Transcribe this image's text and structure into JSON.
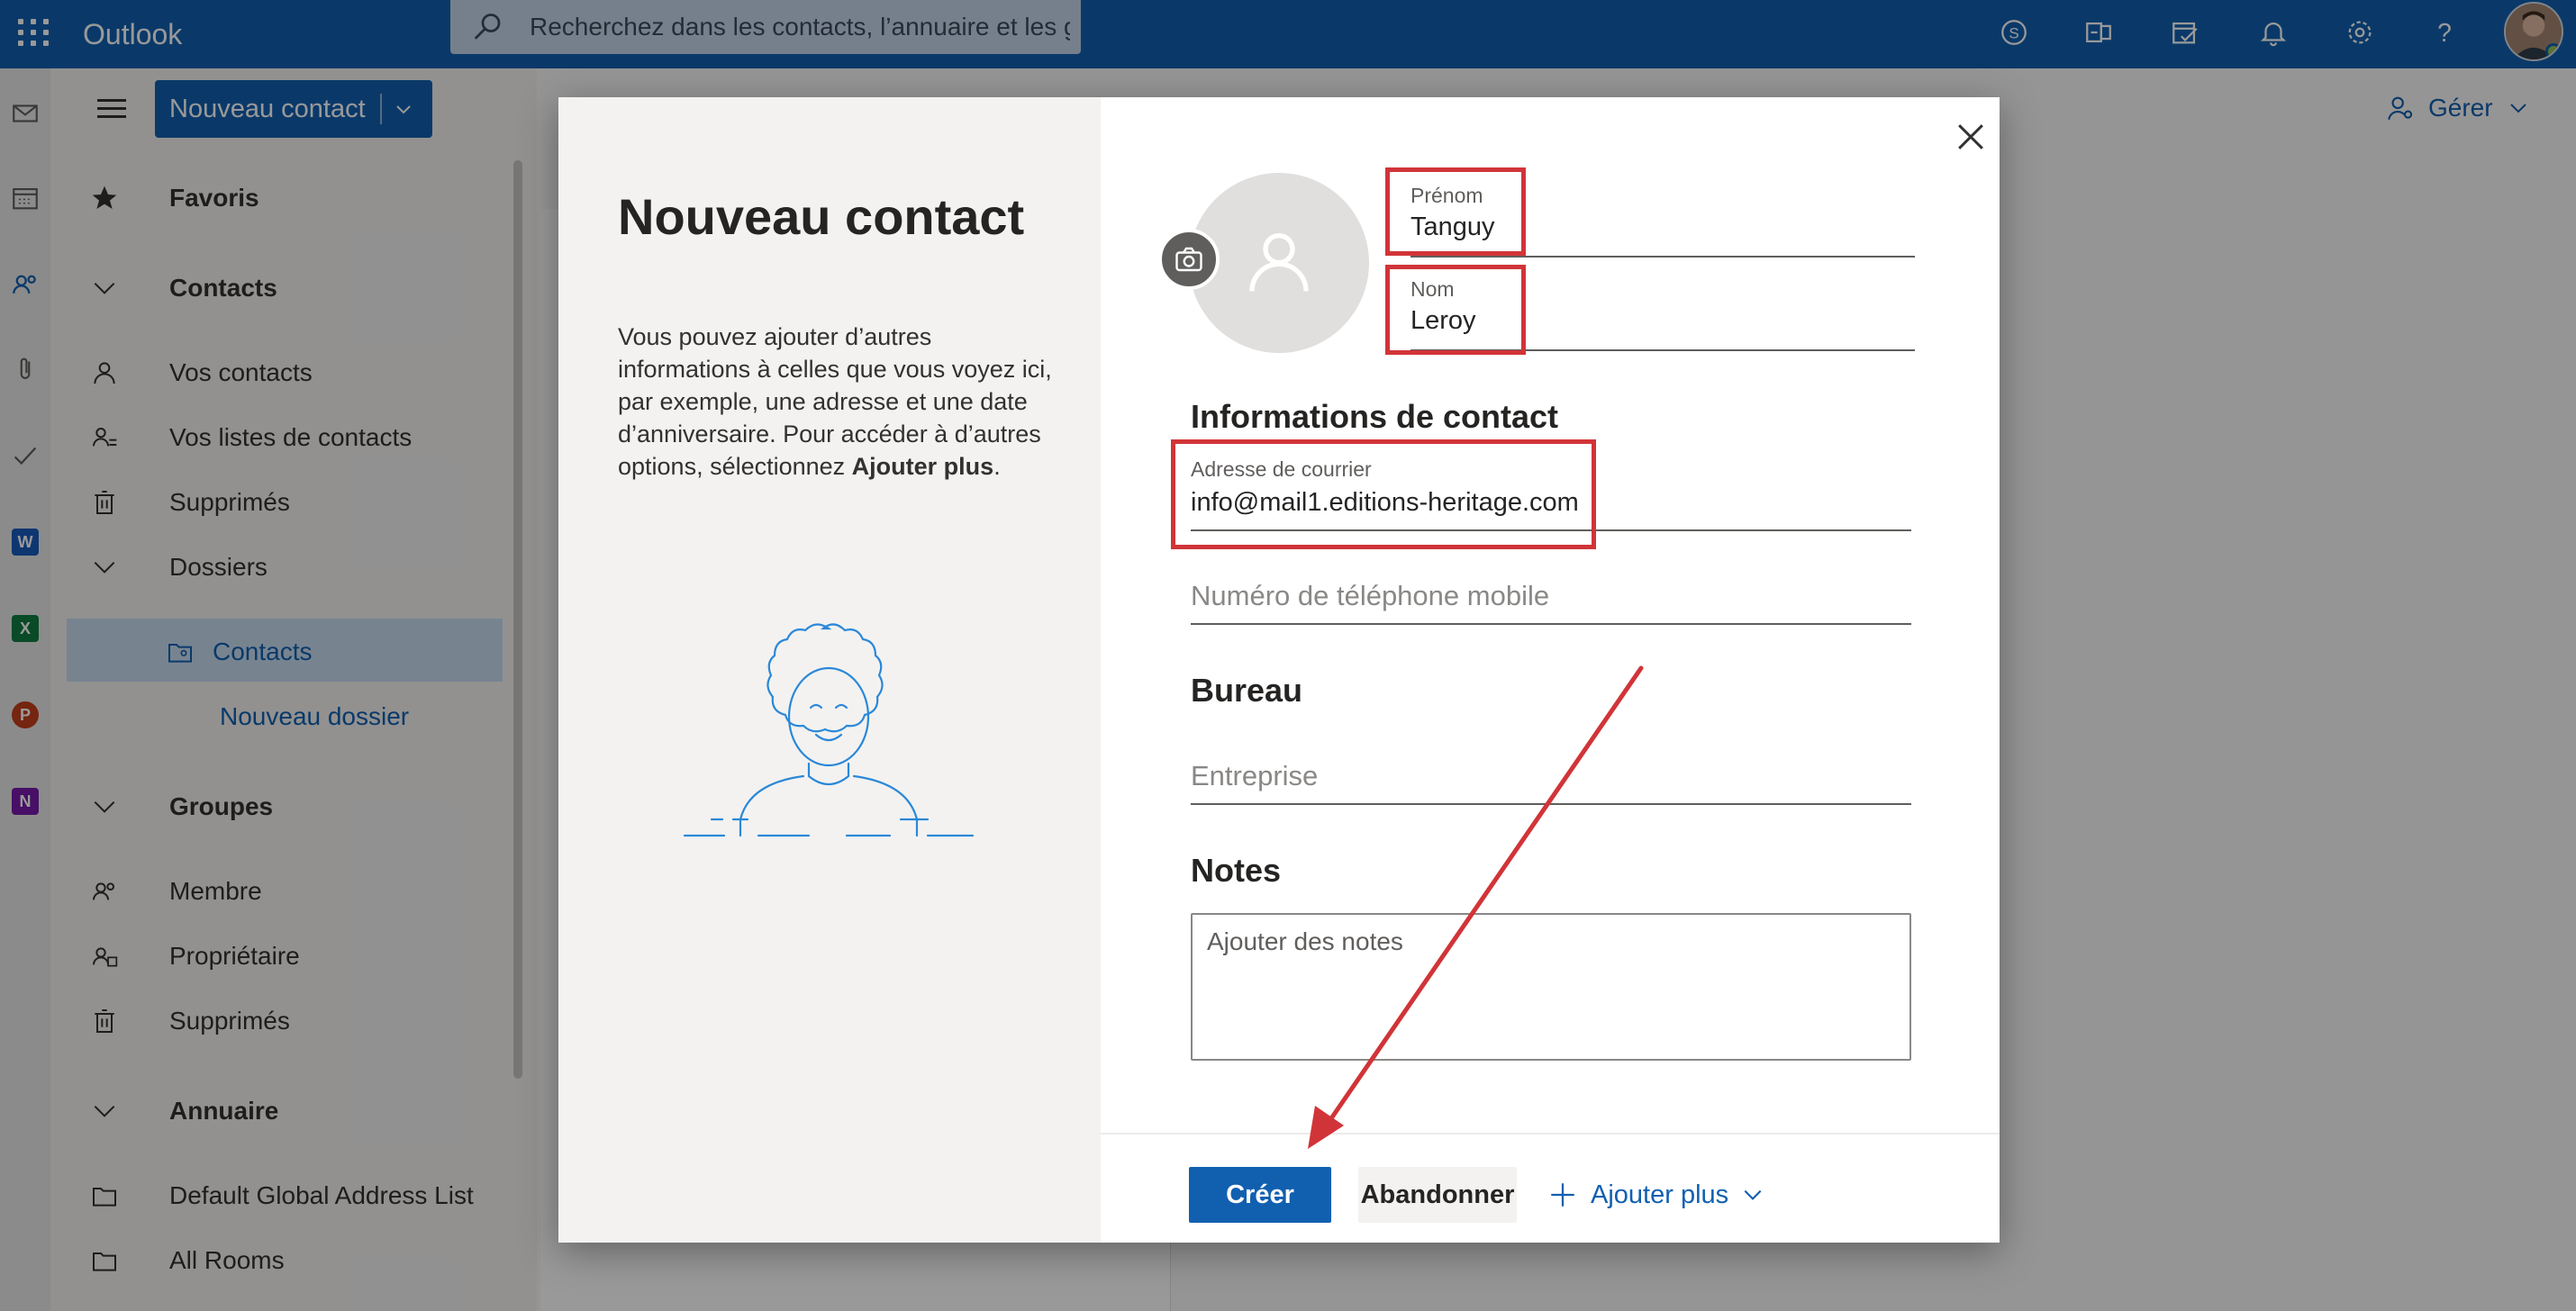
{
  "topbar": {
    "app_name": "Outlook",
    "search_placeholder": "Recherchez dans les contacts, l’annuaire et les g..."
  },
  "toolbar": {
    "new_contact_label": "Nouveau contact",
    "manage_label": "Gérer"
  },
  "nav": {
    "favorites": "Favoris",
    "contacts_header": "Contacts",
    "your_contacts": "Vos contacts",
    "contact_lists": "Vos listes de contacts",
    "deleted": "Supprimés",
    "folders": "Dossiers",
    "contacts_folder": "Contacts",
    "new_folder": "Nouveau dossier",
    "groups": "Groupes",
    "member": "Membre",
    "owner": "Propriétaire",
    "groups_deleted": "Supprimés",
    "directory": "Annuaire",
    "global_address_list": "Default Global Address List",
    "all_rooms": "All Rooms"
  },
  "dialog": {
    "title": "Nouveau contact",
    "desc_text": "Vous pouvez ajouter d’autres informations à celles que vous voyez ici, par exemple, une adresse et une date d’anniversaire. Pour accéder à d’autres options, sélectionnez ",
    "desc_bold": "Ajouter plus",
    "desc_end": ".",
    "first_name_label": "Prénom",
    "first_name_value": "Tanguy",
    "last_name_label": "Nom",
    "last_name_value": "Leroy",
    "contact_info_header": "Informations de contact",
    "email_label": "Adresse de courrier",
    "email_value": "info@mail1.editions-heritage.com",
    "mobile_placeholder": "Numéro de téléphone mobile",
    "office_header": "Bureau",
    "company_placeholder": "Entreprise",
    "notes_header": "Notes",
    "notes_placeholder": "Ajouter des notes",
    "create_label": "Créer",
    "discard_label": "Abandonner",
    "add_more_label": "Ajouter plus"
  },
  "colors": {
    "brand": "#1160b0",
    "annotation": "#d13438"
  }
}
